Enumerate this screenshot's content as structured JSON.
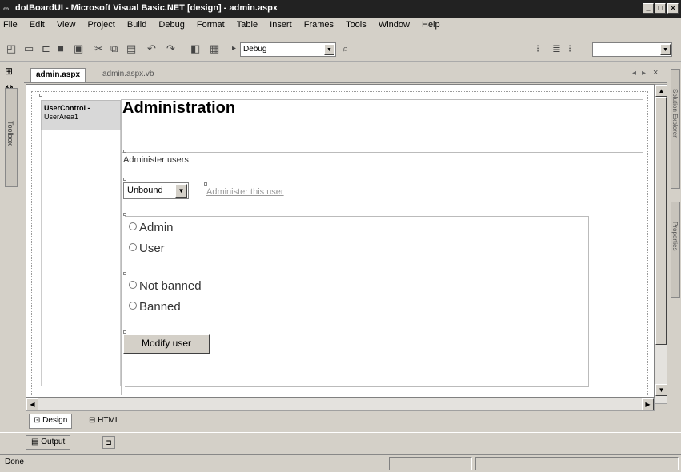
{
  "window": {
    "title": "dotBoardUI - Microsoft Visual Basic.NET [design] - admin.aspx",
    "controls": [
      "_",
      "□",
      "×"
    ]
  },
  "menu": [
    "File",
    "Edit",
    "View",
    "Project",
    "Build",
    "Debug",
    "Format",
    "Table",
    "Insert",
    "Frames",
    "Tools",
    "Window",
    "Help"
  ],
  "toolbar": {
    "config_value": "Debug"
  },
  "side_tabs": {
    "toolbox": "Toolbox",
    "solution_explorer": "Solution Explorer",
    "properties": "Properties"
  },
  "doc_tabs": [
    {
      "label": "admin.aspx",
      "active": true
    },
    {
      "label": "admin.aspx.vb",
      "active": false
    }
  ],
  "design": {
    "user_control_title": "UserControl -",
    "user_control_name": "UserArea1",
    "heading": "Administration",
    "administer_users": "Administer users",
    "select_value": "Unbound",
    "administer_link": "Administer this user",
    "role_options": [
      "Admin",
      "User"
    ],
    "ban_options": [
      "Not banned",
      "Banned"
    ],
    "modify_button": "Modify user"
  },
  "view_tabs": [
    {
      "label": "Design",
      "active": true
    },
    {
      "label": "HTML",
      "active": false
    }
  ],
  "output": {
    "tab_label": "Output"
  },
  "status": {
    "text": "Done"
  }
}
